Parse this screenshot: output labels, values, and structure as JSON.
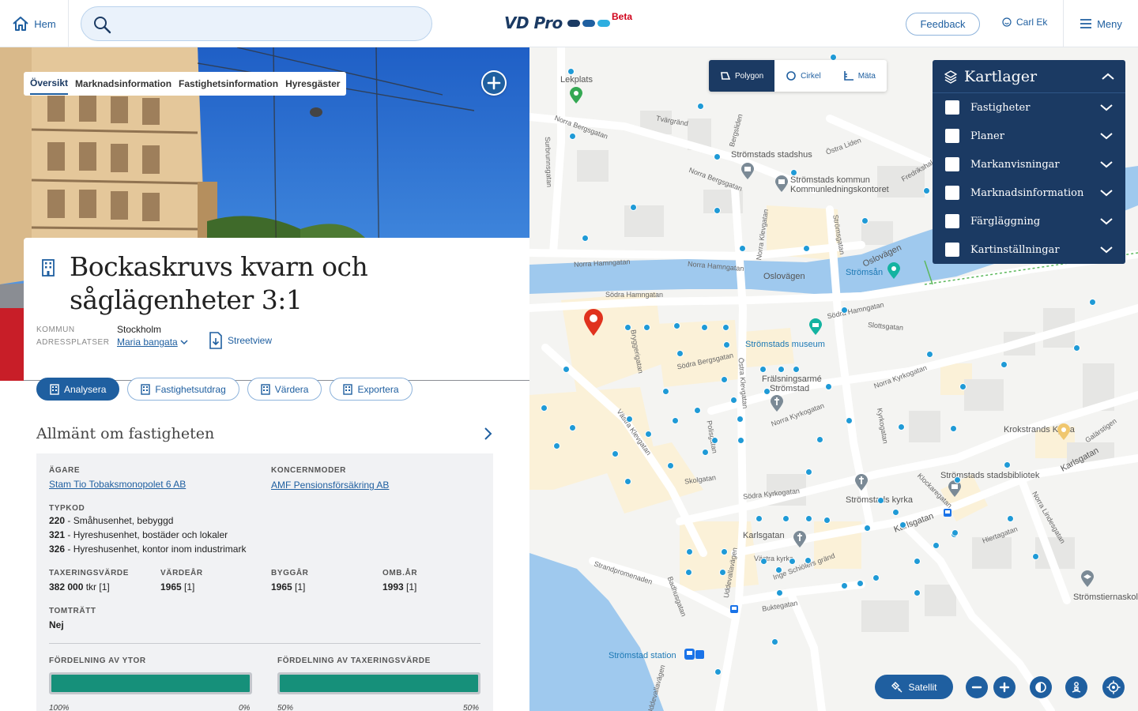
{
  "header": {
    "home_label": "Hem",
    "search_placeholder": "",
    "logo_text": "VD Pro",
    "logo_dot_colors": [
      "#1b3a63",
      "#1f5fa0",
      "#2eaee0"
    ],
    "beta_label": "Beta",
    "feedback_label": "Feedback",
    "user_name": "Carl Ek",
    "menu_label": "Meny"
  },
  "tabs": [
    {
      "label": "Översikt",
      "active": true
    },
    {
      "label": "Marknadsinformation",
      "active": false
    },
    {
      "label": "Fastighetsinformation",
      "active": false
    },
    {
      "label": "Hyresgäster",
      "active": false
    }
  ],
  "property": {
    "title": "Bockaskruvs kvarn och såglägenheter 3:1",
    "kommun_label": "KOMMUN",
    "kommun_value": "Stockholm",
    "adress_label": "ADRESSPLATSER",
    "adress_value": "Maria bangata",
    "streetview_label": "Streetview"
  },
  "actions": {
    "analysera": "Analysera",
    "fastighetsutdrag": "Fastighetsutdrag",
    "vardera": "Värdera",
    "exportera": "Exportera"
  },
  "general": {
    "heading": "Allmänt om fastigheten",
    "agare_label": "ÄGARE",
    "agare_value": "Stam Tio Tobaksmonopolet 6 AB",
    "koncern_label": "KONCERNMODER",
    "koncern_value": "AMF Pensionsförsäkring AB",
    "typkod_label": "TYPKOD",
    "typkoder": [
      {
        "code": "220",
        "text": " - Småhusenhet, bebyggd"
      },
      {
        "code": "321",
        "text": " - Hyreshusenhet, bostäder och lokaler"
      },
      {
        "code": "326",
        "text": " - Hyreshusenhet, kontor inom industrimark"
      }
    ],
    "taxvarde_label": "TAXERINGSVÄRDE",
    "taxvarde_value": "382 000",
    "taxvarde_suffix": " tkr [1]",
    "vardear_label": "VÄRDEÅR",
    "vardear_value": "1965",
    "vardear_suffix": " [1]",
    "byggar_label": "BYGGÅR",
    "byggar_value": "1965",
    "byggar_suffix": " [1]",
    "ombar_label": "OMB.ÅR",
    "ombar_value": "1993",
    "ombar_suffix": " [1]",
    "tomtratt_label": "TOMTRÄTT",
    "tomtratt_value": "Nej",
    "ytor_label": "FÖRDELNING AV YTOR",
    "ytor_fill": 1.0,
    "ytor_left": "100%",
    "ytor_right": "0%",
    "tax_label": "FÖRDELNING AV TAXERINGSVÄRDE",
    "tax_fill": 1.0,
    "tax_left": "50%",
    "tax_right": "50%"
  },
  "map": {
    "tools": [
      {
        "label": "Polygon",
        "active": true
      },
      {
        "label": "Cirkel",
        "active": false
      },
      {
        "label": "Mäta",
        "active": false
      }
    ],
    "layers_title": "Kartlager",
    "layers": [
      "Fastigheter",
      "Planer",
      "Markanvisningar",
      "Marknadsinformation",
      "Färgläggning",
      "Kartinställningar"
    ],
    "satellite_label": "Satellit",
    "labels": {
      "lekplats": "Lekplats",
      "stadshus": "Strömstads stadshus",
      "kommun1": "Strömstads kommun",
      "kommun2": "Kommunledningskontoret",
      "osloveg1": "Oslovägen",
      "osloveg2": "Oslovägen",
      "stromsan": "Strömsån",
      "museum": "Strömstads museum",
      "fralsning1": "Frälsningsarmé",
      "fralsning2": "Strömstad",
      "krokstrand": "Krokstrands Kyrka",
      "bibliotek": "Strömstads stadsbibliotek",
      "kyrka": "Strömstads kyrka",
      "karlsgatan1": "Karlsgatan",
      "karlsgatan2": "Karlsgatan",
      "karlsgatan3": "Karlsgatan",
      "vastkyrka": "Västra kyrka",
      "station": "Strömstad station",
      "stromstiern": "Strömstiernaskolan",
      "norra_hamn1": "Norra Hamngatan",
      "norra_hamn2": "Norra Hamngatan",
      "sodra_hamn1": "Södra Hamngatan",
      "sodra_hamn2": "Södra Hamngatan",
      "tvargrand": "Tvärgränd",
      "norra_berg1": "Norra Bergsgatan",
      "norra_berg2": "Norra Bergsgatan",
      "ostra_lid": "Östra Liden",
      "ostra_klev": "Östra Klevgatan",
      "vastra_klev": "Västra Klevgatan",
      "sodra_berg": "Södra Bergsgatan",
      "norra_kyrko1": "Norra Kyrkogatan",
      "norra_kyrko2": "Norra Kyrkogatan",
      "sodra_kyrko": "Södra Kyrkogatan",
      "skolgatan": "Skolgatan",
      "strandprom": "Strandpromenaden",
      "uddevalla1": "Uddevallavägen",
      "uddevalla2": "Uddevallavägen",
      "bukte": "Buktegatan",
      "inge": "Inge Schiölers gränd",
      "badhus": "Badhusgatan",
      "hierta": "Hiertagatan",
      "klockar": "Klockaregatan",
      "kyrkogatan": "Kyrkogatan",
      "polis": "Polisgatan",
      "fredriksh": "Fredrikshald",
      "slotts": "Slottsgatan",
      "strom": "Strömsgatan",
      "kleva": "Norra Klevgatan",
      "berglid": "Bergsliden",
      "surbrunns": "Surbrunnsgatan",
      "norra_lin": "Norra Lindesgatan",
      "galarstig": "Galärstigen",
      "bryggeri": "Bryggerigatan"
    }
  }
}
